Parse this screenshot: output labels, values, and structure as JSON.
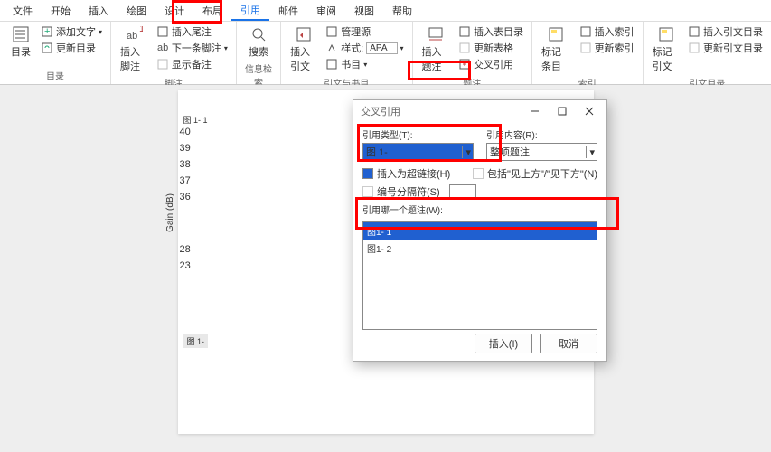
{
  "menu": {
    "items": [
      "文件",
      "开始",
      "插入",
      "绘图",
      "设计",
      "布局",
      "引用",
      "邮件",
      "审阅",
      "视图",
      "帮助"
    ],
    "active_index": 6
  },
  "ribbon": {
    "toc": {
      "label": "目录",
      "main": "目录",
      "add_text": "添加文字",
      "update": "更新目录"
    },
    "footnote": {
      "label": "脚注",
      "main": "插入脚注",
      "sub": "ab",
      "endnote": "插入尾注",
      "next": "下一条脚注",
      "show": "显示备注"
    },
    "search": {
      "label": "信息检索",
      "main": "搜索"
    },
    "citation": {
      "label": "引文与书目",
      "main": "插入引文",
      "manage": "管理源",
      "style_label": "样式:",
      "style_value": "APA",
      "biblio": "书目"
    },
    "caption": {
      "label": "题注",
      "main": "插入题注",
      "toc": "插入表目录",
      "update": "更新表格",
      "cross": "交叉引用"
    },
    "index": {
      "label": "索引",
      "mark": "标记条目",
      "insert": "插入索引",
      "update": "更新索引"
    },
    "toa": {
      "label": "引文目录",
      "mark": "标记引文",
      "insert": "插入引文目录",
      "update": "更新引文目录"
    }
  },
  "dialog": {
    "title": "交叉引用",
    "type_label": "引用类型(T):",
    "type_value": "图 1-",
    "content_label": "引用内容(R):",
    "content_value": "整项题注",
    "hyperlink": "插入为超链接(H)",
    "include": "包括\"见上方\"/\"见下方\"(N)",
    "sep": "编号分隔符(S)",
    "list_label": "引用哪一个题注(W):",
    "items": [
      "图1- 1",
      "图1- 2"
    ],
    "selected_index": 0,
    "insert": "插入(I)",
    "cancel": "取消"
  },
  "page": {
    "caption": "图 1- 1",
    "ylabel": "Gain (dB)",
    "yticks": [
      "40",
      "39",
      "38",
      "37",
      "36",
      "28",
      "23"
    ],
    "fig_bottom": "图 1-"
  }
}
